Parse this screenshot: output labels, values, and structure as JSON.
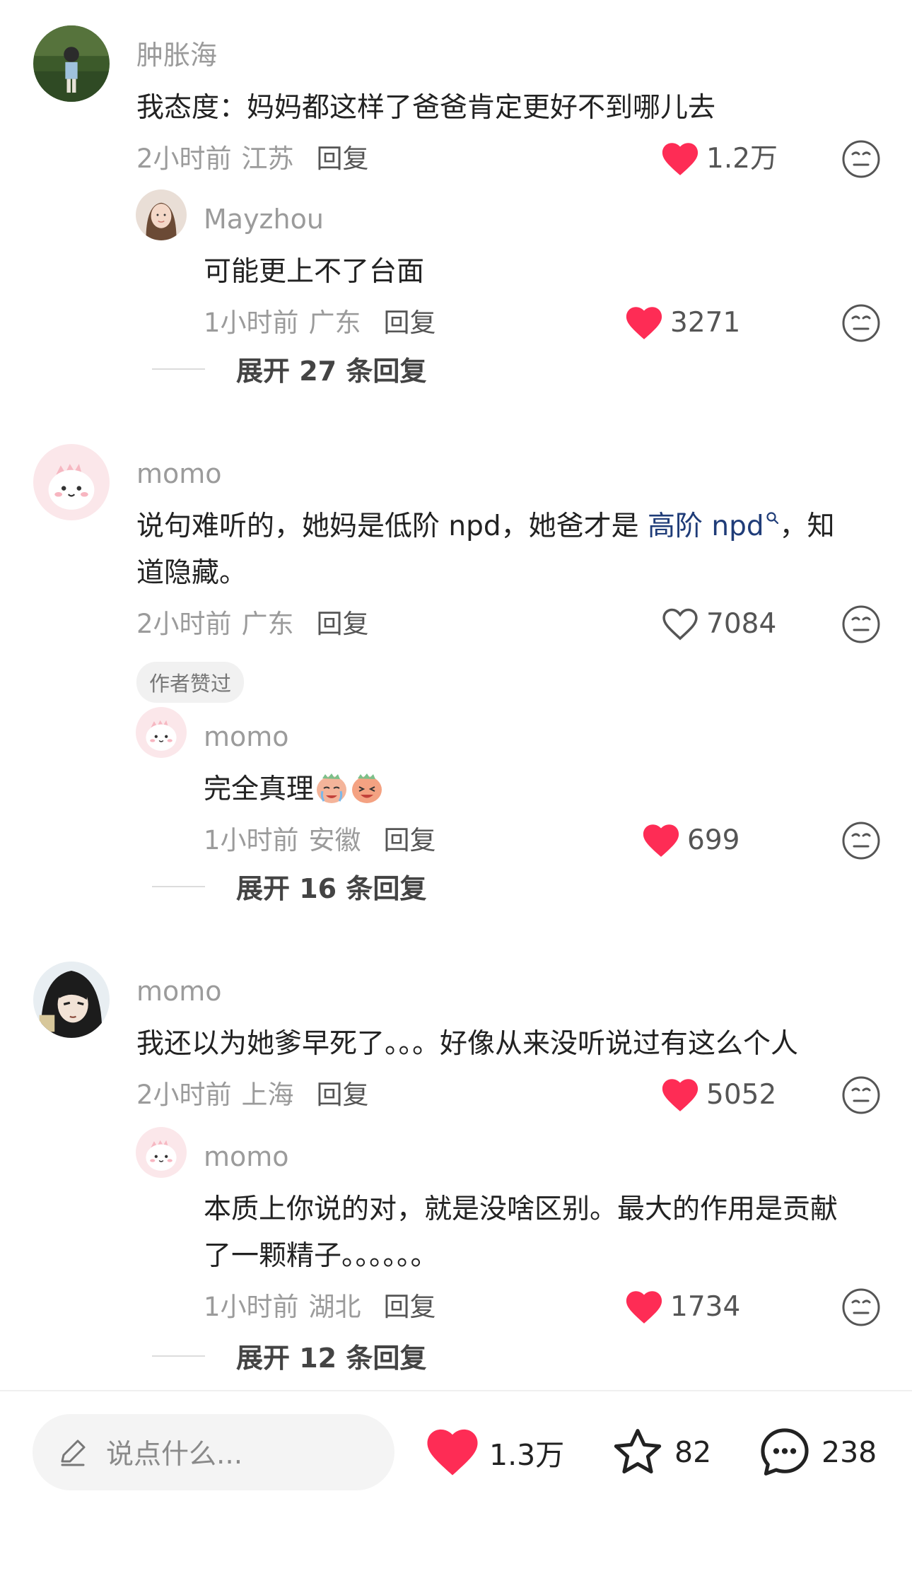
{
  "comments": [
    {
      "username": "肿胀海",
      "text": "我态度：妈妈都这样了爸爸肯定更好不到哪儿去",
      "time": "2小时前",
      "location": "江苏",
      "reply_label": "回复",
      "likes": "1.2万",
      "liked": true,
      "replies": [
        {
          "username": "Mayzhou",
          "text": "可能更上不了台面",
          "time": "1小时前",
          "location": "广东",
          "reply_label": "回复",
          "likes": "3271",
          "liked": true
        }
      ],
      "expand_label": "展开 27 条回复"
    },
    {
      "username": "momo",
      "text_before": "说句难听的，她妈是低阶 npd，她爸才是 ",
      "topic_link": "高阶 npd",
      "text_after": "，知道隐藏。",
      "time": "2小时前",
      "location": "广东",
      "reply_label": "回复",
      "likes": "7084",
      "liked": false,
      "badge": "作者赞过",
      "replies": [
        {
          "username": "momo",
          "text": "完全真理",
          "time": "1小时前",
          "location": "安徽",
          "reply_label": "回复",
          "likes": "699",
          "liked": true
        }
      ],
      "expand_label": "展开 16 条回复"
    },
    {
      "username": "momo",
      "text": "我还以为她爹早死了。。。好像从来没听说过有这么个人",
      "time": "2小时前",
      "location": "上海",
      "reply_label": "回复",
      "likes": "5052",
      "liked": true,
      "replies": [
        {
          "username": "momo",
          "text": "本质上你说的对，就是没啥区别。最大的作用是贡献了一颗精子。。。。。。",
          "time": "1小时前",
          "location": "湖北",
          "reply_label": "回复",
          "likes": "1734",
          "liked": true
        }
      ],
      "expand_label": "展开 12 条回复"
    }
  ],
  "bottom_bar": {
    "input_placeholder": "说点什么...",
    "likes": "1.3万",
    "favorites": "82",
    "comments": "238"
  },
  "colors": {
    "heart": "#fe2c55",
    "topic_link": "#1f3c78",
    "meta_text": "#9b9b9b"
  },
  "icons": [
    "heart-icon",
    "heart-outline-icon",
    "emoji-react-icon",
    "search-mini-icon",
    "pencil-icon",
    "star-icon",
    "chat-bubble-icon"
  ]
}
